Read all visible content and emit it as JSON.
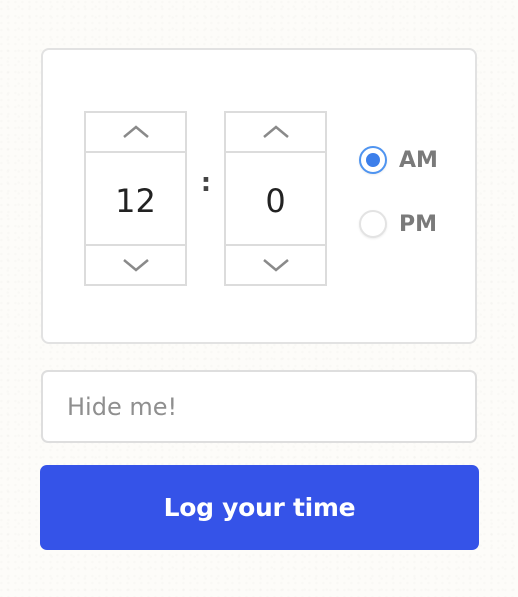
{
  "time_picker": {
    "hours": {
      "value": "12",
      "up_icon": "chevron-up-icon",
      "down_icon": "chevron-down-icon"
    },
    "separator": ":",
    "minutes": {
      "value": "0",
      "up_icon": "chevron-up-icon",
      "down_icon": "chevron-down-icon"
    },
    "period": {
      "options": [
        {
          "label": "AM",
          "checked": true
        },
        {
          "label": "PM",
          "checked": false
        }
      ],
      "selected": "AM"
    }
  },
  "text_field": {
    "placeholder": "Hide me!",
    "value": ""
  },
  "submit": {
    "label": "Log your time"
  },
  "colors": {
    "accent": "#3553e8",
    "radio_checked": "#3d7fea",
    "border": "#dcdcdc",
    "background": "#fdfcf9"
  }
}
